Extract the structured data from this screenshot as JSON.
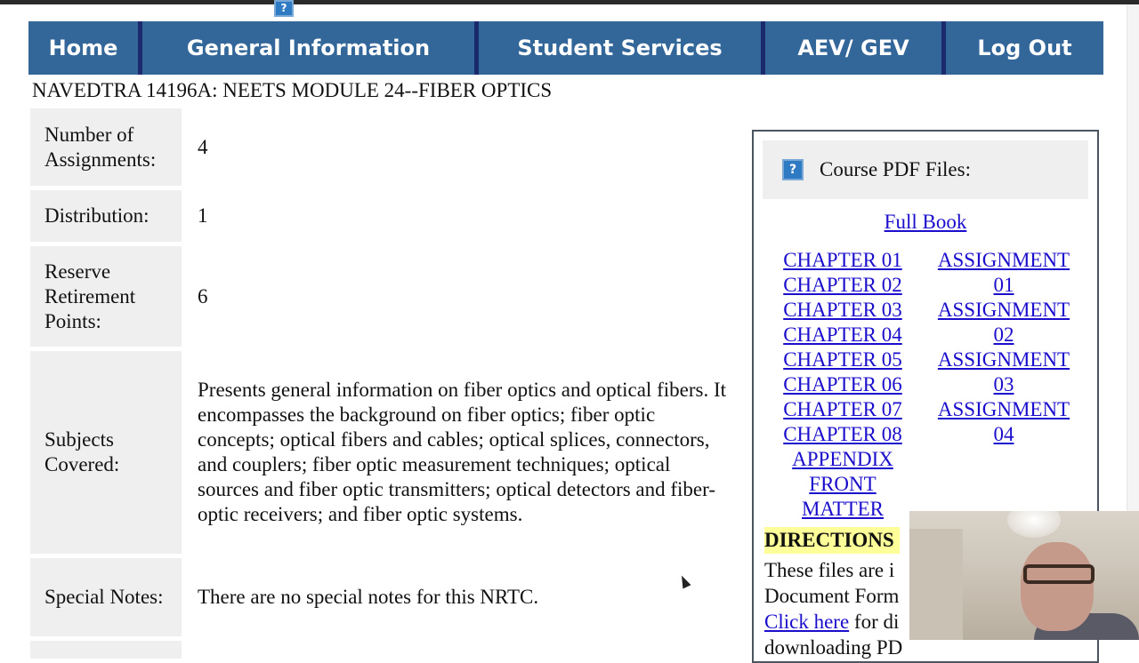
{
  "nav": {
    "items": [
      {
        "label": "Home"
      },
      {
        "label": "General Information"
      },
      {
        "label": "Student Services"
      },
      {
        "label": "AEV/ GEV"
      },
      {
        "label": "Log Out"
      }
    ]
  },
  "help_icon_glyph": "?",
  "page_title": "NAVEDTRA 14196A: NEETS MODULE 24--FIBER OPTICS",
  "info": {
    "rows": [
      {
        "label": "Number of Assignments:",
        "value": "4"
      },
      {
        "label": "Distribution:",
        "value": "1"
      },
      {
        "label": "Reserve Retirement Points:",
        "value": "6"
      },
      {
        "label": "Subjects Covered:",
        "value": "Presents general information on fiber optics and optical fibers. It encompasses the background on fiber optics; fiber optic concepts; optical fibers and cables; optical splices, connectors, and couplers; fiber optic measurement techniques; optical sources and fiber optic transmitters; optical detectors and fiber-optic receivers; and fiber optic systems."
      },
      {
        "label": "Special Notes:",
        "value": "There are no special notes for this NRTC."
      }
    ]
  },
  "sidebar": {
    "title": "Course PDF Files:",
    "full_book": "Full Book",
    "chapters": [
      "CHAPTER 01",
      "CHAPTER 02",
      "CHAPTER 03",
      "CHAPTER 04",
      "CHAPTER 05",
      "CHAPTER 06",
      "CHAPTER 07",
      "CHAPTER 08",
      "APPENDIX",
      "FRONT MATTER"
    ],
    "assignments": [
      "ASSIGNMENT 01",
      "ASSIGNMENT 02",
      "ASSIGNMENT 03",
      "ASSIGNMENT 04"
    ],
    "directions_heading": "DIRECTIONS",
    "directions_line1": "These files are i",
    "directions_line2": "Document Form",
    "click_here": "Click here",
    "directions_line3_rest": " for di",
    "directions_line4": "downloading PD"
  },
  "colors": {
    "nav_bg": "#336699",
    "nav_divider": "#1a2a6c",
    "label_bg": "#efefef",
    "link": "#1a0dcc",
    "highlight": "#ffff99"
  }
}
